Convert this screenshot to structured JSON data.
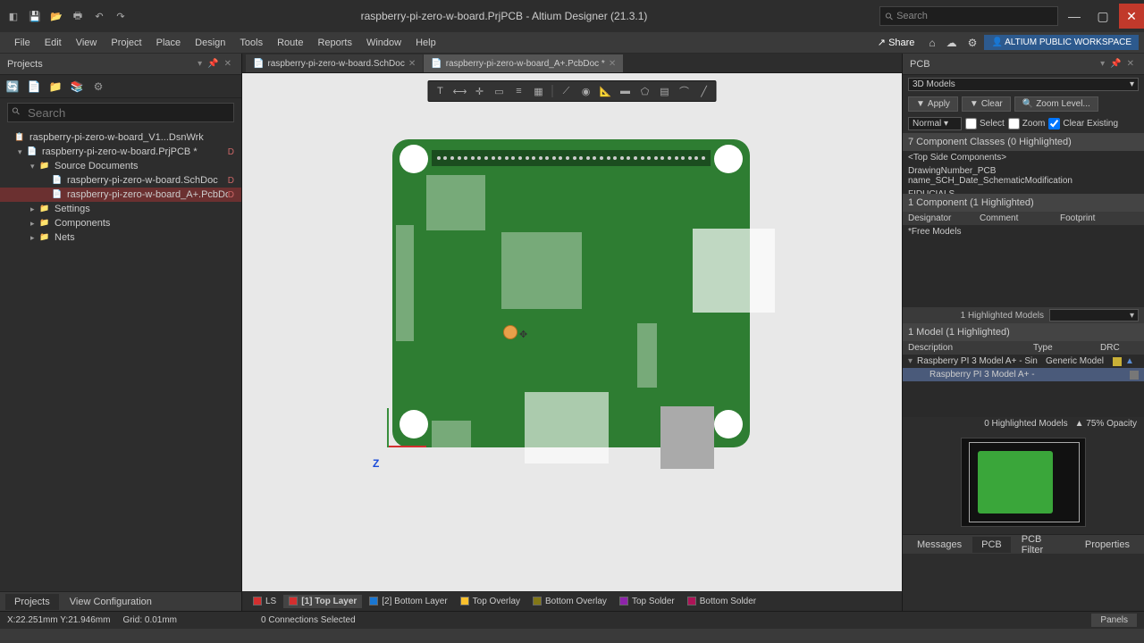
{
  "title": "raspberry-pi-zero-w-board.PrjPCB - Altium Designer (21.3.1)",
  "top_search_placeholder": "Search",
  "share_label": "Share",
  "workspace_label": "ALTIUM PUBLIC WORKSPACE",
  "menus": [
    "File",
    "Edit",
    "View",
    "Project",
    "Place",
    "Design",
    "Tools",
    "Route",
    "Reports",
    "Window",
    "Help"
  ],
  "left_panel": {
    "title": "Projects",
    "search_placeholder": "Search",
    "tree": [
      {
        "indent": 0,
        "caret": "",
        "icon": "📋",
        "label": "raspberry-pi-zero-w-board_V1...DsnWrk",
        "badge": ""
      },
      {
        "indent": 1,
        "caret": "▾",
        "icon": "📄",
        "label": "raspberry-pi-zero-w-board.PrjPCB *",
        "badge": "D"
      },
      {
        "indent": 2,
        "caret": "▾",
        "icon": "📁",
        "label": "Source Documents",
        "badge": ""
      },
      {
        "indent": 3,
        "caret": "",
        "icon": "📄",
        "label": "raspberry-pi-zero-w-board.SchDoc",
        "badge": "D"
      },
      {
        "indent": 3,
        "caret": "",
        "icon": "📄",
        "label": "raspberry-pi-zero-w-board_A+.PcbDoc *",
        "badge": "D",
        "selected": true
      },
      {
        "indent": 2,
        "caret": "▸",
        "icon": "📁",
        "label": "Settings",
        "badge": ""
      },
      {
        "indent": 2,
        "caret": "▸",
        "icon": "📁",
        "label": "Components",
        "badge": ""
      },
      {
        "indent": 2,
        "caret": "▸",
        "icon": "📁",
        "label": "Nets",
        "badge": ""
      }
    ]
  },
  "bottom_left_tabs": [
    "Projects",
    "View Configuration"
  ],
  "doc_tabs": [
    {
      "label": "raspberry-pi-zero-w-board.SchDoc",
      "active": false
    },
    {
      "label": "raspberry-pi-zero-w-board_A+.PcbDoc *",
      "active": true
    }
  ],
  "layers": [
    {
      "color": "#d32f2f",
      "label": "LS"
    },
    {
      "color": "#d32f2f",
      "label": "[1] Top Layer",
      "active": true
    },
    {
      "color": "#1976d2",
      "label": "[2] Bottom Layer"
    },
    {
      "color": "#fbc02d",
      "label": "Top Overlay"
    },
    {
      "color": "#827717",
      "label": "Bottom Overlay"
    },
    {
      "color": "#8e24aa",
      "label": "Top Solder"
    },
    {
      "color": "#ad1457",
      "label": "Bottom Solder"
    }
  ],
  "right_panel": {
    "title": "PCB",
    "dropdown": "3D Models",
    "apply": "Apply",
    "clear": "Clear",
    "zoom": "Zoom Level...",
    "mode": "Normal",
    "cb_select": "Select",
    "cb_zoom": "Zoom",
    "cb_clear": "Clear Existing",
    "classes_hdr": "7 Component Classes (0 Highlighted)",
    "class_rows": [
      "<Top Side Components>",
      "DrawingNumber_PCB name_SCH_Date_SchematicModification",
      "FIDUCIALS"
    ],
    "comp_hdr": "1 Component (1 Highlighted)",
    "comp_cols": [
      "Designator",
      "Comment",
      "Footprint"
    ],
    "comp_row": "*Free Models",
    "hl_models_1": "1 Highlighted Models",
    "model_hdr": "1 Model (1 Highlighted)",
    "model_cols": [
      "Description",
      "Type",
      "DRC"
    ],
    "model_parent": "Raspberry PI 3 Model A+ - Sin",
    "model_parent_type": "Generic Model",
    "model_child": "Raspberry PI 3 Model A+ -",
    "hl_models_0": "0 Highlighted Models",
    "opacity": "75% Opacity"
  },
  "bottom_right_tabs": [
    "Messages",
    "PCB",
    "PCB Filter",
    "Properties"
  ],
  "status": {
    "coords": "X:22.251mm Y:21.946mm",
    "grid": "Grid: 0.01mm",
    "conns": "0 Connections Selected",
    "panels": "Panels"
  },
  "axis_label": "Z"
}
